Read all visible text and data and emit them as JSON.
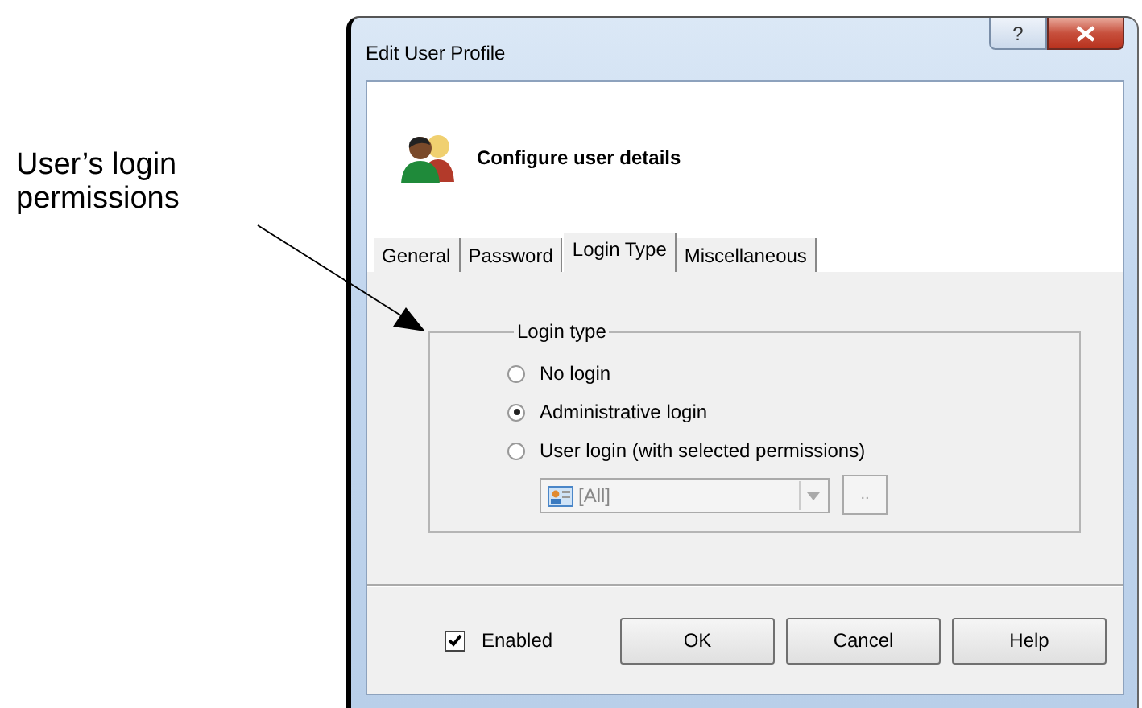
{
  "annotation": {
    "text": "User’s login permissions"
  },
  "window": {
    "title": "Edit User Profile",
    "help_button": "?"
  },
  "header": {
    "title": "Configure user details"
  },
  "tabs": [
    {
      "label": "General",
      "selected": false
    },
    {
      "label": "Password",
      "selected": false
    },
    {
      "label": "Login Type",
      "selected": true
    },
    {
      "label": "Miscellaneous",
      "selected": false
    }
  ],
  "login_group": {
    "legend": "Login type",
    "options": [
      {
        "label": "No login",
        "selected": false
      },
      {
        "label": "Administrative login",
        "selected": true
      },
      {
        "label": "User login (with selected permissions)",
        "selected": false
      }
    ],
    "permissions_dropdown": {
      "value": "[All]",
      "disabled": true
    },
    "browse_button": {
      "label": "..",
      "disabled": true
    }
  },
  "enabled": {
    "label": "Enabled",
    "checked": true
  },
  "buttons": [
    "OK",
    "Cancel",
    "Help"
  ]
}
